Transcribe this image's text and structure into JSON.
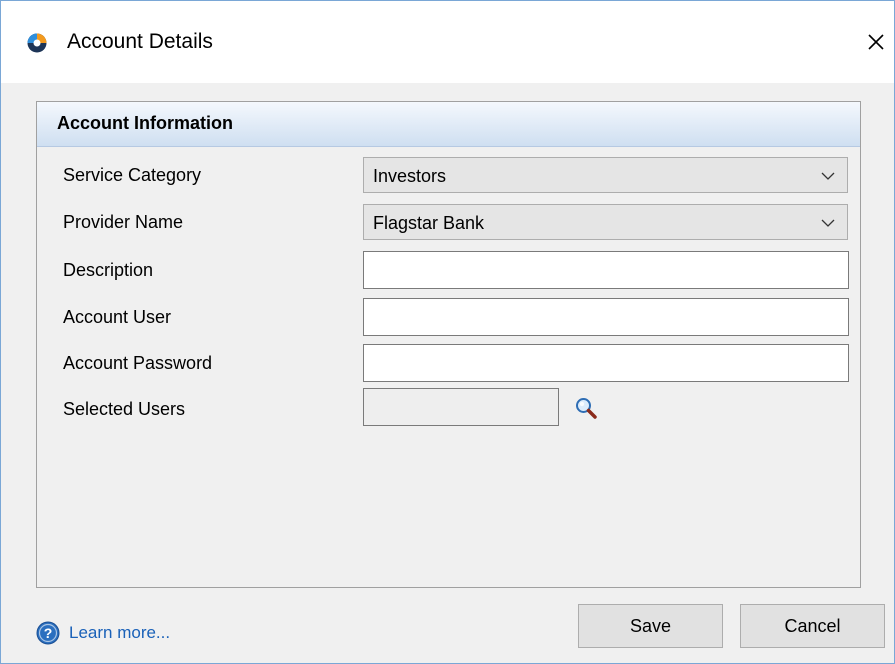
{
  "window": {
    "title": "Account Details"
  },
  "panel": {
    "header": "Account Information"
  },
  "form": {
    "service_category": {
      "label": "Service Category",
      "value": "Investors"
    },
    "provider_name": {
      "label": "Provider Name",
      "value": "Flagstar Bank"
    },
    "description": {
      "label": "Description",
      "value": ""
    },
    "account_user": {
      "label": "Account User",
      "value": ""
    },
    "account_password": {
      "label": "Account Password",
      "value": ""
    },
    "selected_users": {
      "label": "Selected Users",
      "value": ""
    }
  },
  "footer": {
    "learn_more": "Learn more...",
    "save_label": "Save",
    "cancel_label": "Cancel"
  },
  "icons": {
    "app": "app-logo-icon",
    "close": "close-icon",
    "dropdown": "chevron-down-icon",
    "search": "magnifier-icon",
    "help": "help-icon"
  },
  "colors": {
    "window_border": "#7aa7d6",
    "header_gradient_top": "#f4f8fd",
    "header_gradient_bottom": "#cfdff1",
    "link": "#1a61b8",
    "help_icon": "#2b6fbf"
  }
}
